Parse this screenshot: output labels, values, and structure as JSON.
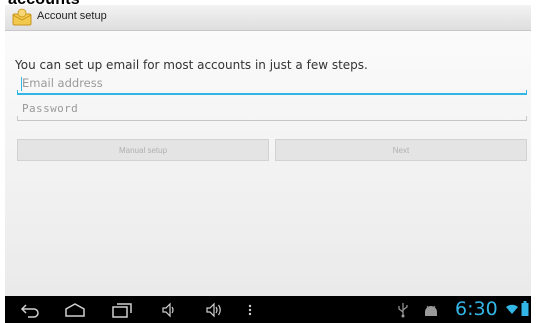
{
  "page_caption": "accounts",
  "action_bar": {
    "icon": "account-setup-icon",
    "title": "Account setup"
  },
  "form": {
    "intro_text": "You can set up email for most accounts in just a few steps.",
    "email_placeholder": "Email address",
    "password_placeholder": "Password",
    "manual_setup_label": "Manual setup",
    "next_label": "Next"
  },
  "status": {
    "time": "6:30",
    "icons": [
      "usb-icon",
      "android-icon",
      "wifi-icon",
      "battery-icon"
    ]
  },
  "nav": {
    "icons": [
      "back-icon",
      "home-icon",
      "recent-apps-icon",
      "volume-down-icon",
      "volume-up-icon",
      "menu-icon"
    ]
  },
  "colors": {
    "accent": "#33b5e5",
    "navbar_bg": "#000000"
  }
}
